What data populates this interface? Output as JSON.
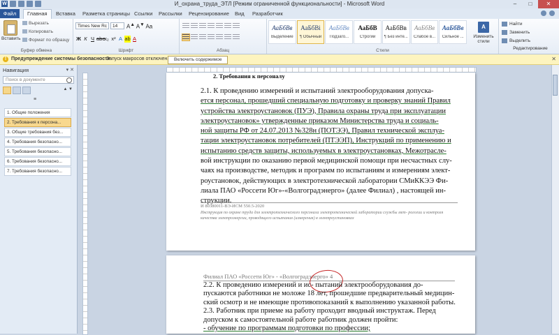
{
  "window": {
    "title": "И_охрана_труда_ЭТЛ [Режим ограниченной функциональности] - Microsoft Word"
  },
  "tabs": [
    "Файл",
    "Главная",
    "Вставка",
    "Разметка страницы",
    "Ссылки",
    "Рассылки",
    "Рецензирование",
    "Вид",
    "Разработчик"
  ],
  "ribbon": {
    "clipboard": {
      "paste": "Вставить",
      "cut": "Вырезать",
      "copy": "Копировать",
      "format_painter": "Формат по образцу",
      "label": "Буфер обмена"
    },
    "font": {
      "name": "Times New Rc",
      "size": "14",
      "label": "Шрифт"
    },
    "paragraph": {
      "label": "Абзац"
    },
    "styles": {
      "label": "Стили",
      "items": [
        {
          "preview": "АаБбВв",
          "name": "Выделение"
        },
        {
          "preview": "АаБбВі",
          "name": "¶ Обычный"
        },
        {
          "preview": "АаБбВв",
          "name": "Подзаго..."
        },
        {
          "preview": "АаБбВ",
          "name": "Строгий"
        },
        {
          "preview": "АаБбВв",
          "name": "¶ Без инте..."
        },
        {
          "preview": "АаБбВв",
          "name": "Слабое в..."
        },
        {
          "preview": "АаБбВв",
          "name": "Сильное ..."
        }
      ],
      "change": "Изменить стили"
    },
    "editing": {
      "find": "Найти",
      "replace": "Заменить",
      "select": "Выделить",
      "label": "Редактирование"
    }
  },
  "security_bar": {
    "title": "Предупреждение системы безопасности",
    "text": "Запуск макросов отключен.",
    "button": "Включить содержимое"
  },
  "nav_pane": {
    "title": "Навигация",
    "search_placeholder": "Поиск в документе",
    "items": [
      "1. Общие положения",
      "2. Требования к персона...",
      "3. Общие требования без...",
      "4. Требования безопасно...",
      "5. Требования безопасно...",
      "6. Требования безопасно...",
      "7. Требования безопасно..."
    ],
    "selected_index": 1
  },
  "document": {
    "page1": {
      "heading": "2.  Требования к персоналу",
      "para_lines": [
        "2.1. К проведению измерений и испытаний электрооборудования допуска-",
        "ется персонал, прошедший специальную подготовку и проверку знаний Правил",
        "устройства электроустановок (ПУЭ), Правила охраны труда при эксплуатации",
        "электроустановок»  утвержденные приказом Министерства  труда  и  социаль-",
        "ной защиты РФ от 24.07.2013 №328н (ПОТЭЭ), Правил технической эксплуа-",
        "тации электроустановок потребителей (ПТЭЭП), Инструкций по применению и",
        "испытанию средств защиты, используемых в электроустановках, Межотрасле-",
        "вой инструкции по оказанию первой медицинской помощи при несчастных слу-",
        "чаях на производстве, методик и программ по испытаниям и измерениям элект-",
        "роустановок, действующих в электротехнической лаборатории СМиККЭЭ Фи-",
        "лиала ПАО «Россети Юг»-«Волгоградэнерго» (далее Филиал) , настоящей ин-",
        "струкции."
      ],
      "footer_id": "И 80380011-ВЭ-ИСМ 550.5-2020",
      "footer_text": "Инструкция по охране труда для электротехнического персонала электротехнической лаборатории службы мет- рологии и контроля качества электроэнергии, проводящего испытания (измерения) в электроустановках"
    },
    "page2": {
      "header": "Филиал ПАО «Россети Юг» - «Волгоградэнерго» 4",
      "para_lines": [
        "2.2. К проведению измерений и ис-       пытаний электрооборудования до-",
        "пускаются работники не моложе 18 лет, прошедшие предварительный медицин-",
        "ский осмотр и не имеющие противопоказаний к выполнению указанной работы.",
        "2.3. Работник при приеме на работу проходит вводный инструктаж. Перед",
        "допуском к самостоятельной работе работник должен пройти:",
        "- обучение по программам подготовки по профессии;"
      ]
    }
  }
}
